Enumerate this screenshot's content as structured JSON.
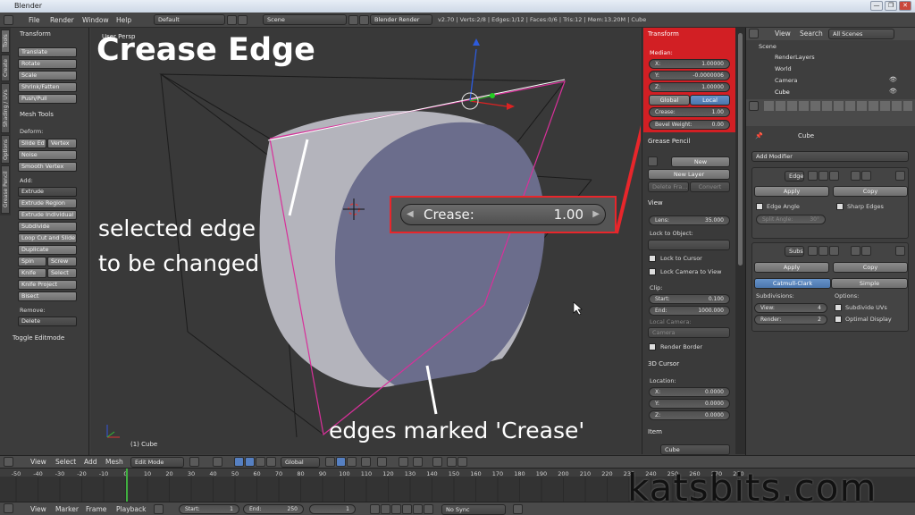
{
  "window": {
    "title": "Blender",
    "controls": [
      "—",
      "❐",
      "✕"
    ]
  },
  "infobar": {
    "menus": [
      "File",
      "Render",
      "Window",
      "Help"
    ],
    "layout": "Default",
    "scene": "Scene",
    "engine": "Blender Render",
    "stats": "v2.70 | Verts:2/8 | Edges:1/12 | Faces:0/6 | Tris:12 | Mem:13.20M | Cube"
  },
  "toolshelf": {
    "tabs": [
      "Tools",
      "Create",
      "Shading / UVs",
      "Options",
      "Grease Pencil"
    ],
    "transform_header": "Transform",
    "transform_buttons": [
      "Translate",
      "Rotate",
      "Scale",
      "Shrink/Fatten",
      "Push/Pull"
    ],
    "mesh_tools_header": "Mesh Tools",
    "deform_label": "Deform:",
    "slide_edge": "Slide Ed",
    "vertex": "Vertex",
    "noise": "Noise",
    "smooth_vertex": "Smooth Vertex",
    "add_label": "Add:",
    "extrude": "Extrude",
    "add_buttons": [
      "Extrude Region",
      "Extrude Individual",
      "Subdivide",
      "Loop Cut and Slide",
      "Duplicate"
    ],
    "spin": "Spin",
    "screw": "Screw",
    "knife": "Knife",
    "select": "Select",
    "knife_project": "Knife Project",
    "bisect": "Bisect",
    "remove_label": "Remove:",
    "delete": "Delete",
    "toggle_editmode": "Toggle Editmode"
  },
  "viewport": {
    "view_label": "User Persp",
    "object_label": "(1) Cube",
    "title_annotation": "Crease Edge",
    "annotation_selected_line1": "selected edge",
    "annotation_selected_line2": "to be changed",
    "annotation_marked": "edges marked 'Crease'",
    "crease_popup_label": "Crease:",
    "crease_popup_value": "1.00",
    "watermark": "katsbits.com"
  },
  "npanel": {
    "transform_header": "Transform",
    "median_label": "Median:",
    "x_label": "X:",
    "x_value": "1.00000",
    "y_label": "Y:",
    "y_value": "-0.0000006",
    "z_label": "Z:",
    "z_value": "1.00000",
    "global": "Global",
    "local": "Local",
    "crease_label": "Crease:",
    "crease_value": "1.00",
    "bevel_label": "Bevel Weight:",
    "bevel_value": "0.00",
    "grease_header": "Grease Pencil",
    "new": "New",
    "new_layer": "New Layer",
    "delete_frame": "Delete Fra...",
    "convert": "Convert",
    "view_header": "View",
    "lens_label": "Lens:",
    "lens_value": "35.000",
    "lock_object_label": "Lock to Object:",
    "lock_cursor": "Lock to Cursor",
    "lock_camera": "Lock Camera to View",
    "clip_label": "Clip:",
    "start_label": "Start:",
    "start_value": "0.100",
    "end_label": "End:",
    "end_value": "1000.000",
    "local_camera_label": "Local Camera:",
    "camera": "Camera",
    "render_border": "Render Border",
    "cursor_header": "3D Cursor",
    "location_label": "Location:",
    "cx_value": "0.0000",
    "cy_value": "0.0000",
    "cz_value": "0.0000",
    "item_header": "Item",
    "item_name": "Cube"
  },
  "outliner": {
    "view": "View",
    "search": "Search",
    "filter": "All Scenes",
    "items": [
      "Scene",
      "RenderLayers",
      "World",
      "Camera",
      "Cube"
    ]
  },
  "properties": {
    "object": "Cube",
    "add_modifier": "Add Modifier",
    "mod1_name": "Edge",
    "apply": "Apply",
    "copy": "Copy",
    "edge_angle": "Edge Angle",
    "sharp_edges": "Sharp Edges",
    "split_angle": "Split Angle:",
    "split_value": "30°",
    "mod2_name": "Subs",
    "catmull": "Catmull-Clark",
    "simple": "Simple",
    "subdivisions_label": "Subdivisions:",
    "options_label": "Options:",
    "view_label": "View:",
    "view_value": "4",
    "render_label": "Render:",
    "render_value": "2",
    "subdivide_uvs": "Subdivide UVs",
    "optimal_display": "Optimal Display"
  },
  "header3d": {
    "menus": [
      "View",
      "Select",
      "Add",
      "Mesh"
    ],
    "mode": "Edit Mode",
    "orientation": "Global"
  },
  "timeline": {
    "ticks": [
      "-50",
      "-40",
      "-30",
      "-20",
      "-10",
      "0",
      "10",
      "20",
      "30",
      "40",
      "50",
      "60",
      "70",
      "80",
      "90",
      "100",
      "110",
      "120",
      "130",
      "140",
      "150",
      "160",
      "170",
      "180",
      "190",
      "200",
      "210",
      "220",
      "230",
      "240",
      "250",
      "260",
      "270",
      "280"
    ],
    "menus": [
      "View",
      "Marker",
      "Frame",
      "Playback"
    ],
    "start_label": "Start:",
    "start_value": "1",
    "end_label": "End:",
    "end_value": "250",
    "current": "1",
    "sync": "No Sync"
  },
  "colors": {
    "accent_red": "#e8262b",
    "selected_blue": "#5680c2",
    "crease_pink": "#d8309a"
  }
}
